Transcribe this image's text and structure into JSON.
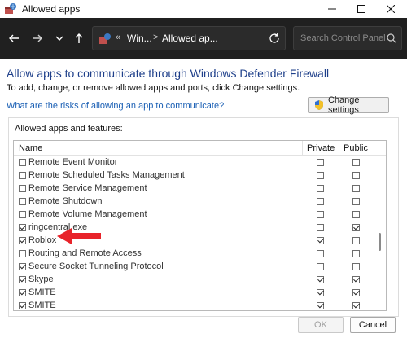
{
  "window": {
    "title": "Allowed apps",
    "controls": [
      "minimize-icon",
      "maximize-icon",
      "close-icon"
    ]
  },
  "nav": {
    "icons": [
      "back-arrow-icon",
      "forward-arrow-icon",
      "recent-locations-chevron-icon",
      "up-arrow-icon",
      "refresh-icon"
    ],
    "breadcrumb": {
      "overflow": "«",
      "segments": [
        "Win...",
        "Allowed ap..."
      ],
      "separator": ">"
    },
    "search": {
      "placeholder": "Search Control Panel"
    }
  },
  "content": {
    "heading": "Allow apps to communicate through Windows Defender Firewall",
    "subtext": "To add, change, or remove allowed apps and ports, click Change settings.",
    "risk_link": "What are the risks of allowing an app to communicate?",
    "change_settings_label": "Change settings",
    "group_label": "Allowed apps and features:"
  },
  "table": {
    "columns": {
      "name": "Name",
      "private": "Private",
      "public": "Public"
    },
    "rows": [
      {
        "name": "Remote Event Monitor",
        "enabled": false,
        "private": false,
        "public": false
      },
      {
        "name": "Remote Scheduled Tasks Management",
        "enabled": false,
        "private": false,
        "public": false
      },
      {
        "name": "Remote Service Management",
        "enabled": false,
        "private": false,
        "public": false
      },
      {
        "name": "Remote Shutdown",
        "enabled": false,
        "private": false,
        "public": false
      },
      {
        "name": "Remote Volume Management",
        "enabled": false,
        "private": false,
        "public": false
      },
      {
        "name": "ringcentral.exe",
        "enabled": true,
        "private": false,
        "public": true
      },
      {
        "name": "Roblox",
        "enabled": true,
        "private": true,
        "public": false
      },
      {
        "name": "Routing and Remote Access",
        "enabled": false,
        "private": false,
        "public": false
      },
      {
        "name": "Secure Socket Tunneling Protocol",
        "enabled": true,
        "private": false,
        "public": false
      },
      {
        "name": "Skype",
        "enabled": true,
        "private": true,
        "public": true
      },
      {
        "name": "SMITE",
        "enabled": true,
        "private": true,
        "public": true
      },
      {
        "name": "SMITE",
        "enabled": true,
        "private": true,
        "public": true
      }
    ]
  },
  "annotation": {
    "arrow_color": "#e8232a",
    "points_to": "Roblox"
  },
  "footer": {
    "ok_label": "OK",
    "cancel_label": "Cancel"
  },
  "colors": {
    "nav_background": "#202020",
    "heading_blue": "#1e3f8a",
    "link_blue": "#1a5fb4"
  }
}
